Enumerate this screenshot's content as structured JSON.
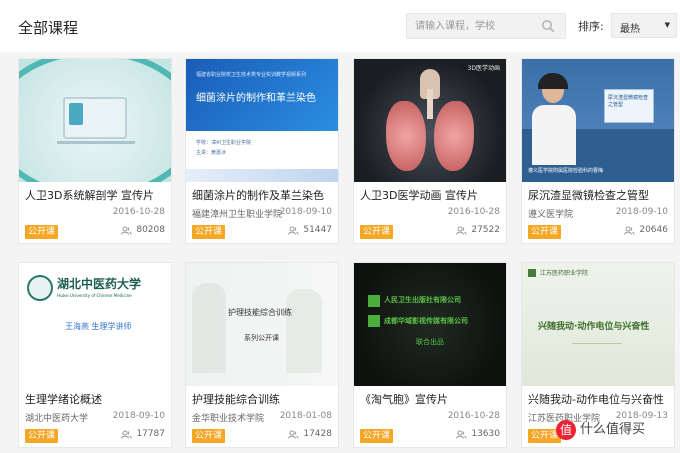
{
  "header": {
    "title": "全部课程",
    "search_placeholder": "请输入课程，学校",
    "sort_label": "排序:",
    "sort_value": "最热"
  },
  "courses": [
    {
      "title": "人卫3D系统解剖学 宣传片",
      "school": "",
      "date": "2016-10-28",
      "views": "80208",
      "badge": "公开课"
    },
    {
      "title": "细菌涂片的制作及革兰染色",
      "school": "福建漳州卫生职业学院",
      "date": "2018-09-10",
      "views": "51447",
      "badge": "公开课",
      "thumb": {
        "header": "福建省职业院校卫生技术类专业实训教学视频系列",
        "main": "细菌涂片的制作和革兰染色",
        "footer1": "学校：漳州卫生职业学院",
        "footer2": "主讲：黄嘉冰"
      }
    },
    {
      "title": "人卫3D医学动画 宣传片",
      "school": "",
      "date": "2016-10-28",
      "views": "27522",
      "badge": "公开课",
      "thumb": {
        "tag": "3D医学动画"
      }
    },
    {
      "title": "尿沉渣显微镜检查之管型",
      "school": "遵义医学院",
      "date": "2018-09-10",
      "views": "20646",
      "badge": "公开课",
      "thumb": {
        "board": "尿沉渣显微镜检查之管型",
        "caption": "遵义医学院附属医院检验科的曹梅"
      }
    },
    {
      "title": "生理学绪论概述",
      "school": "湖北中医药大学",
      "date": "2018-09-10",
      "views": "17787",
      "badge": "公开课",
      "thumb": {
        "name_cn": "湖北中医药大学",
        "name_en": "Hubei University of Chinese Medicine",
        "lecturer": "王海燕 生理学讲师"
      }
    },
    {
      "title": "护理技能综合训练",
      "school": "金华职业技术学院",
      "date": "2018-01-08",
      "views": "17428",
      "badge": "公开课",
      "thumb": {
        "line1": "护理技能综合训练",
        "line2": "系列公开课"
      }
    },
    {
      "title": "《淘气胞》宣传片",
      "school": "",
      "date": "2016-10-28",
      "views": "13630",
      "badge": "公开课",
      "thumb": {
        "line1": "人民卫生出版社有限公司",
        "line2": "成都华域影视传媒有限公司",
        "line3": "联合出品"
      }
    },
    {
      "title": "兴随我动-动作电位与兴奋性",
      "school": "江苏医药职业学院",
      "date": "2018-09-13",
      "views": "",
      "badge": "公开课",
      "thumb": {
        "school": "江苏医药职业学院",
        "main": "兴随我动·动作电位与兴奋性"
      }
    }
  ],
  "watermark": "值 什么值得买",
  "colors": {
    "badge": "#f5a623",
    "card_border": "#e8e8e8"
  }
}
